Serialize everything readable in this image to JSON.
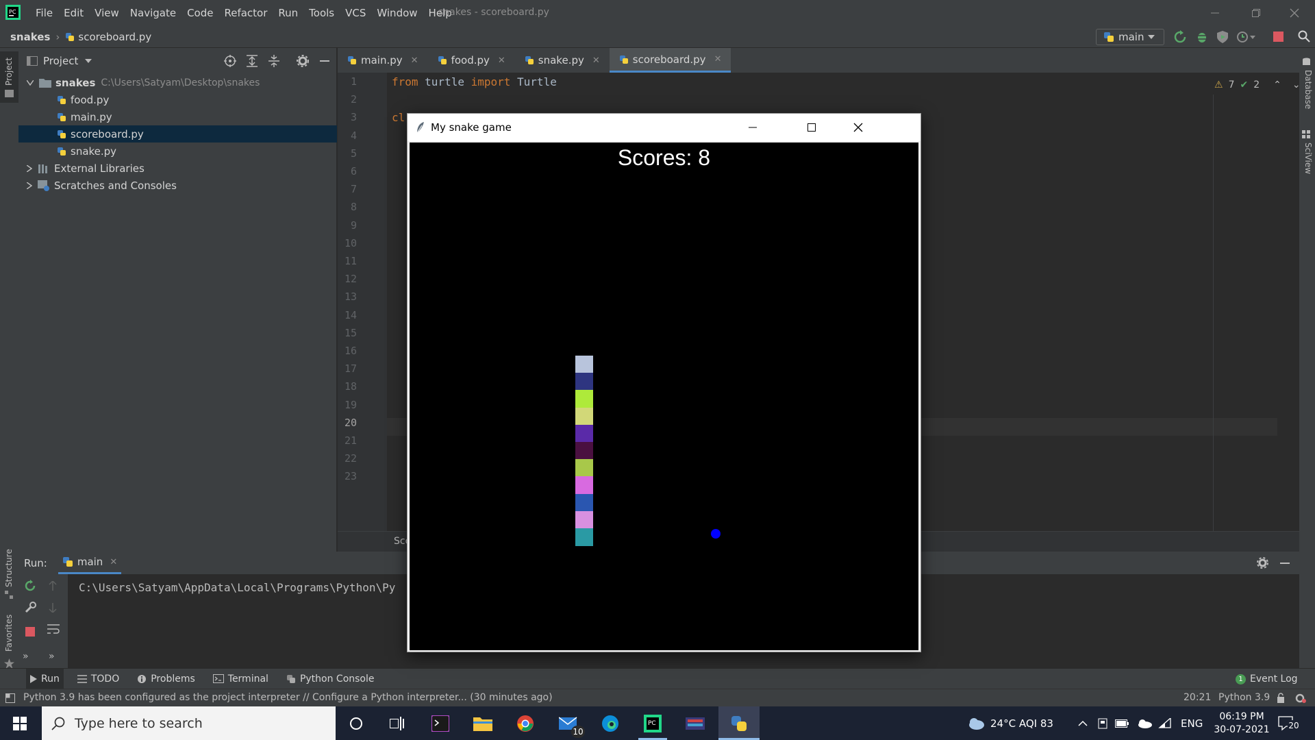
{
  "app": {
    "menu": [
      "File",
      "Edit",
      "View",
      "Navigate",
      "Code",
      "Refactor",
      "Run",
      "Tools",
      "VCS",
      "Window",
      "Help"
    ],
    "window_title": "snakes - scoreboard.py"
  },
  "navbar": {
    "project": "snakes",
    "file": "scoreboard.py",
    "run_config": "main"
  },
  "left_stripe": {
    "project": "Project",
    "structure": "Structure",
    "favorites": "Favorites"
  },
  "right_stripe": {
    "database": "Database",
    "sciview": "SciView"
  },
  "project_panel": {
    "title": "Project",
    "root": {
      "name": "snakes",
      "path": "C:\\Users\\Satyam\\Desktop\\snakes"
    },
    "files": [
      "food.py",
      "main.py",
      "scoreboard.py",
      "snake.py"
    ],
    "selected": "scoreboard.py",
    "external": "External Libraries",
    "scratches": "Scratches and Consoles"
  },
  "editor": {
    "tabs": [
      {
        "label": "main.py"
      },
      {
        "label": "food.py"
      },
      {
        "label": "snake.py"
      },
      {
        "label": "scoreboard.py"
      }
    ],
    "active_tab": "scoreboard.py",
    "line_numbers": [
      "1",
      "2",
      "3",
      "4",
      "5",
      "6",
      "7",
      "8",
      "9",
      "10",
      "11",
      "12",
      "13",
      "14",
      "15",
      "16",
      "17",
      "18",
      "19",
      "20",
      "21",
      "22",
      "23"
    ],
    "current_line": "20",
    "code_line1": {
      "kw1": "from",
      "mod": " turtle ",
      "kw2": "import",
      "name": " Turtle"
    },
    "code_line3_partial": "cl",
    "breadcrumb_partial": "Sco",
    "warnings": "7",
    "checks": "2"
  },
  "run_panel": {
    "label": "Run:",
    "tab": "main",
    "output": "C:\\Users\\Satyam\\AppData\\Local\\Programs\\Python\\Py"
  },
  "tool_tabs": {
    "run": "Run",
    "todo": "TODO",
    "problems": "Problems",
    "terminal": "Terminal",
    "python_console": "Python Console",
    "event_log": "Event Log",
    "event_count": "1"
  },
  "status_bar": {
    "message": "Python 3.9 has been configured as the project interpreter // Configure a Python interpreter... (30 minutes ago)",
    "position": "20:21",
    "interpreter": "Python 3.9"
  },
  "game": {
    "title": "My snake game",
    "score_text": "Scores: 8",
    "segment_colors": [
      "#b8c4dc",
      "#2e3580",
      "#aeea3a",
      "#d2d878",
      "#5a2aa8",
      "#4a1040",
      "#a8c84a",
      "#d86ae0",
      "#2a56b0",
      "#d890e0",
      "#2a9aa4"
    ],
    "food_color": "#0000ff"
  },
  "taskbar": {
    "search_placeholder": "Type here to search",
    "mail_badge": "10",
    "weather": "24°C  AQI 83",
    "lang": "ENG",
    "time": "06:19 PM",
    "date": "30-07-2021",
    "notif_count": "20"
  }
}
